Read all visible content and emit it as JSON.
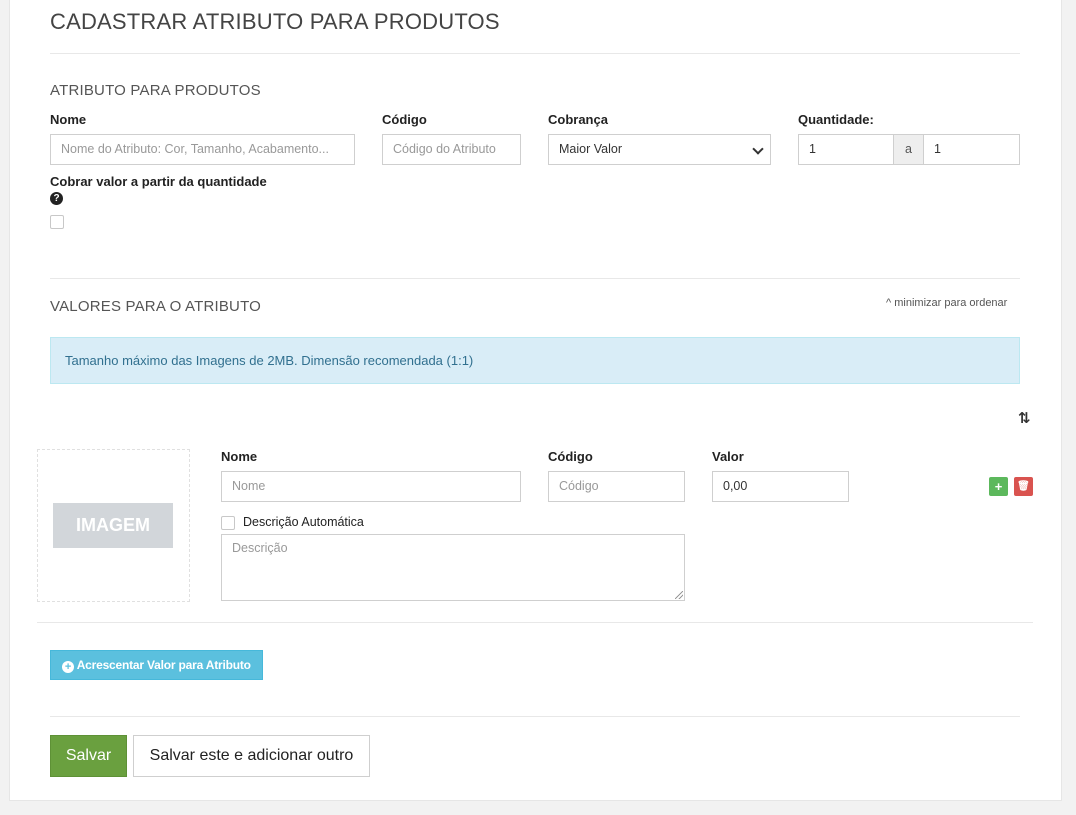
{
  "page_title": "CADASTRAR ATRIBUTO PARA PRODUTOS",
  "attribute_section": {
    "title": "ATRIBUTO PARA PRODUTOS",
    "name_label": "Nome",
    "name_placeholder": "Nome do Atributo: Cor, Tamanho, Acabamento...",
    "code_label": "Código",
    "code_placeholder": "Código do Atributo",
    "charge_label": "Cobrança",
    "charge_selected": "Maior Valor",
    "quantity_label": "Quantidade:",
    "quantity_from": "1",
    "quantity_separator": "a",
    "quantity_to": "1",
    "charge_by_quantity_label": "Cobrar valor a partir da quantidade",
    "help_icon": "?"
  },
  "values_section": {
    "title": "VALORES PARA O ATRIBUTO",
    "minimize_label": "minimizar para ordenar",
    "info_text": "Tamanho máximo das Imagens de 2MB. Dimensão recomendada (1:1)",
    "sort_icon_glyph": "⇅",
    "image_placeholder_text": "IMAGEM",
    "value_row": {
      "name_label": "Nome",
      "name_placeholder": "Nome",
      "code_label": "Código",
      "code_placeholder": "Código",
      "value_label": "Valor",
      "value": "0,00",
      "auto_description_label": "Descrição Automática",
      "description_placeholder": "Descrição",
      "add_glyph": "+",
      "delete_glyph": "🗑"
    },
    "add_value_button": "Acrescentar Valor para Atributo"
  },
  "actions": {
    "save_label": "Salvar",
    "save_and_add_label": "Salvar este e adicionar outro"
  },
  "colors": {
    "save_green": "#6aa03f",
    "info_bg": "#d9edf7",
    "info_text": "#31708f",
    "add_button_blue": "#5bc0de",
    "mini_add_green": "#5cb85c",
    "mini_delete_red": "#d9534f"
  }
}
